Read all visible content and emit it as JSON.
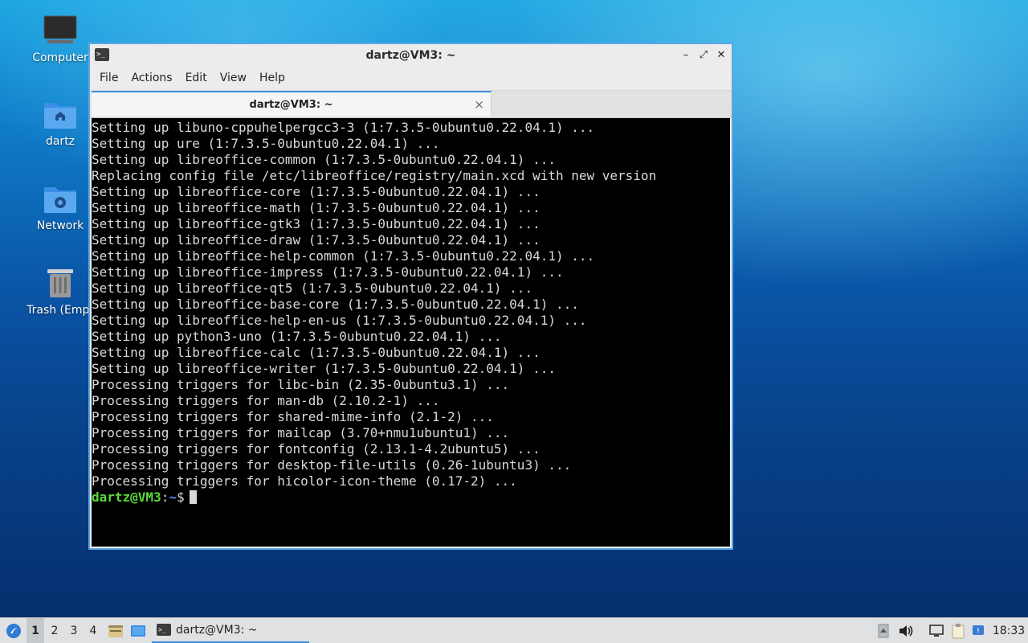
{
  "desktop": {
    "icons": [
      {
        "label": "Computer"
      },
      {
        "label": "dartz"
      },
      {
        "label": "Network"
      },
      {
        "label": "Trash (Empt"
      }
    ]
  },
  "window": {
    "title": "dartz@VM3: ~",
    "menu": [
      "File",
      "Actions",
      "Edit",
      "View",
      "Help"
    ],
    "tab_label": "dartz@VM3: ~",
    "tab_close": "×",
    "controls": {
      "minimize": "–",
      "maximize": "⤢",
      "close": "✕"
    }
  },
  "terminal": {
    "lines": [
      "Setting up libuno-cppuhelpergcc3-3 (1:7.3.5-0ubuntu0.22.04.1) ...",
      "Setting up ure (1:7.3.5-0ubuntu0.22.04.1) ...",
      "Setting up libreoffice-common (1:7.3.5-0ubuntu0.22.04.1) ...",
      "Replacing config file /etc/libreoffice/registry/main.xcd with new version",
      "Setting up libreoffice-core (1:7.3.5-0ubuntu0.22.04.1) ...",
      "Setting up libreoffice-math (1:7.3.5-0ubuntu0.22.04.1) ...",
      "Setting up libreoffice-gtk3 (1:7.3.5-0ubuntu0.22.04.1) ...",
      "Setting up libreoffice-draw (1:7.3.5-0ubuntu0.22.04.1) ...",
      "Setting up libreoffice-help-common (1:7.3.5-0ubuntu0.22.04.1) ...",
      "Setting up libreoffice-impress (1:7.3.5-0ubuntu0.22.04.1) ...",
      "Setting up libreoffice-qt5 (1:7.3.5-0ubuntu0.22.04.1) ...",
      "Setting up libreoffice-base-core (1:7.3.5-0ubuntu0.22.04.1) ...",
      "Setting up libreoffice-help-en-us (1:7.3.5-0ubuntu0.22.04.1) ...",
      "Setting up python3-uno (1:7.3.5-0ubuntu0.22.04.1) ...",
      "Setting up libreoffice-calc (1:7.3.5-0ubuntu0.22.04.1) ...",
      "Setting up libreoffice-writer (1:7.3.5-0ubuntu0.22.04.1) ...",
      "Processing triggers for libc-bin (2.35-0ubuntu3.1) ...",
      "Processing triggers for man-db (2.10.2-1) ...",
      "Processing triggers for shared-mime-info (2.1-2) ...",
      "Processing triggers for mailcap (3.70+nmu1ubuntu1) ...",
      "Processing triggers for fontconfig (2.13.1-4.2ubuntu5) ...",
      "Processing triggers for desktop-file-utils (0.26-1ubuntu3) ...",
      "Processing triggers for hicolor-icon-theme (0.17-2) ..."
    ],
    "prompt": {
      "user_host": "dartz@VM3",
      "sep": ":",
      "path": "~",
      "symbol": "$"
    }
  },
  "taskbar": {
    "workspaces": [
      "1",
      "2",
      "3",
      "4"
    ],
    "active_workspace": "1",
    "task_label": "dartz@VM3: ~",
    "clock": "18:33"
  },
  "colors": {
    "prompt_user": "#5ad93a",
    "prompt_path": "#5a8ef5",
    "accent": "#3d8ee0"
  }
}
